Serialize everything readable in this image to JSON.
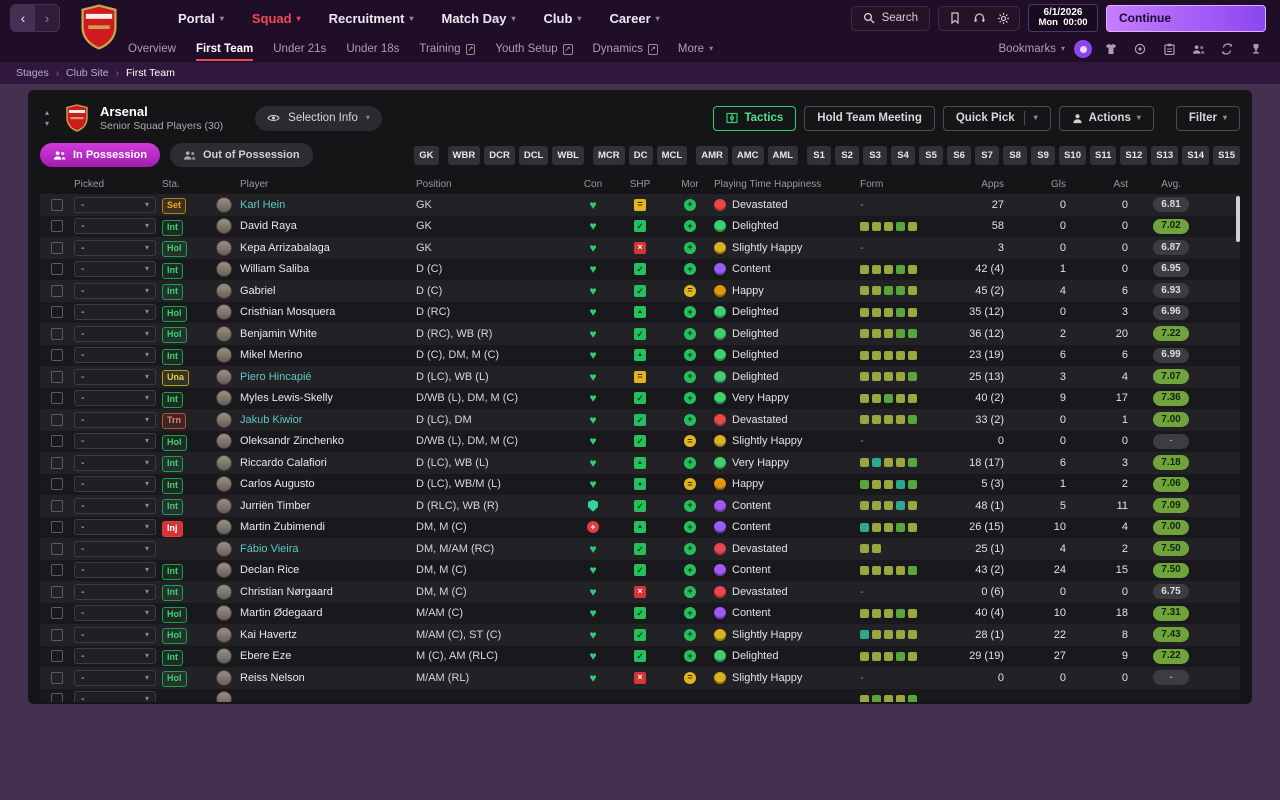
{
  "colors": {
    "bg-page": "#44304f",
    "bg-topbar": "#200e29",
    "accent-red": "#f14950",
    "accent-purple": "#8b46f0",
    "accent-purple-light": "#c77dff",
    "accent-magenta": "#a21caf",
    "accent-green": "#2fd06f",
    "link-teal": "#5ec8be"
  },
  "icons": {
    "chevron_down": "▾",
    "tri_up": "▴",
    "tri_down": "▾",
    "back": "‹",
    "forward": "›",
    "heart": "♥",
    "check": "✓",
    "cross": "×",
    "equals": "=",
    "up": "▲",
    "plus": "+",
    "external": "↗",
    "sep": "›"
  },
  "topbar": {
    "menus": [
      {
        "label": "Portal"
      },
      {
        "label": "Squad",
        "active": true
      },
      {
        "label": "Recruitment"
      },
      {
        "label": "Match Day"
      },
      {
        "label": "Club"
      },
      {
        "label": "Career"
      }
    ],
    "search_label": "Search",
    "date": {
      "date": "6/1/2026",
      "day": "Mon",
      "time": "00:00"
    },
    "continue_label": "Continue"
  },
  "subnav": {
    "items": [
      {
        "label": "Overview"
      },
      {
        "label": "First Team",
        "active": true
      },
      {
        "label": "Under 21s"
      },
      {
        "label": "Under 18s"
      },
      {
        "label": "Training",
        "ext": true
      },
      {
        "label": "Youth Setup",
        "ext": true
      },
      {
        "label": "Dynamics",
        "ext": true
      },
      {
        "label": "More",
        "chevron": true
      }
    ],
    "bookmarks_label": "Bookmarks"
  },
  "breadcrumb": [
    "Stages",
    "Club Site",
    "First Team"
  ],
  "panel": {
    "club_name": "Arsenal",
    "subtitle": "Senior Squad Players (30)",
    "selection_info_label": "Selection Info",
    "buttons": {
      "tactics": "Tactics",
      "hold_team_meeting": "Hold Team Meeting",
      "quick_pick": "Quick Pick",
      "actions": "Actions",
      "filter": "Filter"
    },
    "possession": {
      "in": "In Possession",
      "out": "Out of Possession"
    },
    "position_filters": {
      "groups": [
        [
          "GK"
        ],
        [
          "WBR",
          "DCR",
          "DCL",
          "WBL"
        ],
        [
          "MCR",
          "DC",
          "MCL"
        ],
        [
          "AMR",
          "AMC",
          "AML"
        ],
        [
          "S1",
          "S2",
          "S3",
          "S4",
          "S5",
          "S6",
          "S7",
          "S8",
          "S9",
          "S10",
          "S11",
          "S12",
          "S13",
          "S14",
          "S15"
        ]
      ]
    }
  },
  "table": {
    "columns": [
      "Picked",
      "Sta.",
      "Player",
      "Position",
      "Con",
      "SHP",
      "Mor",
      "Playing Time Happiness",
      "Form",
      "Apps",
      "Gls",
      "Ast",
      "Avg."
    ],
    "rows": [
      {
        "picked": "-",
        "status": "Set",
        "status_type": "set",
        "name": "Karl Hein",
        "link": true,
        "position": "GK",
        "con": "heart",
        "shp": "eq",
        "mor": "good",
        "happiness": "Devastated",
        "happiness_type": "devastated",
        "form": [],
        "apps": "27",
        "gls": "0",
        "ast": "0",
        "avg": "6.81",
        "avg_type": "gray"
      },
      {
        "picked": "-",
        "status": "Int",
        "status_type": "int",
        "name": "David Raya",
        "link": false,
        "position": "GK",
        "con": "heart",
        "shp": "check",
        "mor": "good",
        "happiness": "Delighted",
        "happiness_type": "delighted",
        "form": [
          "o",
          "o",
          "o",
          "g",
          "o"
        ],
        "apps": "58",
        "gls": "0",
        "ast": "0",
        "avg": "7.02",
        "avg_type": "green"
      },
      {
        "picked": "-",
        "status": "Hol",
        "status_type": "hol",
        "name": "Kepa Arrizabalaga",
        "link": false,
        "position": "GK",
        "con": "heart",
        "shp": "x",
        "mor": "good",
        "happiness": "Slightly Happy",
        "happiness_type": "slightly",
        "form": [],
        "apps": "3",
        "gls": "0",
        "ast": "0",
        "avg": "6.87",
        "avg_type": "gray"
      },
      {
        "picked": "-",
        "status": "Int",
        "status_type": "int",
        "name": "William Saliba",
        "link": false,
        "position": "D (C)",
        "con": "heart",
        "shp": "check",
        "mor": "good",
        "happiness": "Content",
        "happiness_type": "content",
        "form": [
          "o",
          "o",
          "o",
          "g",
          "o"
        ],
        "apps": "42 (4)",
        "gls": "1",
        "ast": "0",
        "avg": "6.95",
        "avg_type": "gray"
      },
      {
        "picked": "-",
        "status": "Int",
        "status_type": "int",
        "name": "Gabriel",
        "link": false,
        "position": "D (C)",
        "con": "heart",
        "shp": "check",
        "mor": "ok",
        "happiness": "Happy",
        "happiness_type": "happy",
        "form": [
          "o",
          "o",
          "g",
          "g",
          "o"
        ],
        "apps": "45 (2)",
        "gls": "4",
        "ast": "6",
        "avg": "6.93",
        "avg_type": "gray"
      },
      {
        "picked": "-",
        "status": "Hol",
        "status_type": "hol",
        "name": "Cristhian Mosquera",
        "link": false,
        "position": "D (RC)",
        "con": "heart",
        "shp": "up",
        "mor": "good",
        "happiness": "Delighted",
        "happiness_type": "delighted",
        "form": [
          "o",
          "o",
          "o",
          "g",
          "o"
        ],
        "apps": "35 (12)",
        "gls": "0",
        "ast": "3",
        "avg": "6.96",
        "avg_type": "gray"
      },
      {
        "picked": "-",
        "status": "Hol",
        "status_type": "hol",
        "name": "Benjamin White",
        "link": false,
        "position": "D (RC), WB (R)",
        "con": "heart",
        "shp": "check",
        "mor": "good",
        "happiness": "Delighted",
        "happiness_type": "delighted",
        "form": [
          "o",
          "o",
          "o",
          "g",
          "g"
        ],
        "apps": "36 (12)",
        "gls": "2",
        "ast": "20",
        "avg": "7.22",
        "avg_type": "green"
      },
      {
        "picked": "-",
        "status": "Int",
        "status_type": "int",
        "name": "Mikel Merino",
        "link": false,
        "position": "D (C), DM, M (C)",
        "con": "heart",
        "shp": "up",
        "mor": "good",
        "happiness": "Delighted",
        "happiness_type": "delighted",
        "form": [
          "o",
          "o",
          "o",
          "o",
          "o"
        ],
        "apps": "23 (19)",
        "gls": "6",
        "ast": "6",
        "avg": "6.99",
        "avg_type": "gray"
      },
      {
        "picked": "-",
        "status": "Una",
        "status_type": "una",
        "name": "Piero Hincapié",
        "link": true,
        "position": "D (LC), WB (L)",
        "con": "heart",
        "shp": "eq",
        "mor": "good",
        "happiness": "Delighted",
        "happiness_type": "delighted",
        "form": [
          "o",
          "o",
          "o",
          "o",
          "g"
        ],
        "apps": "25 (13)",
        "gls": "3",
        "ast": "4",
        "avg": "7.07",
        "avg_type": "green"
      },
      {
        "picked": "-",
        "status": "Int",
        "status_type": "int",
        "name": "Myles Lewis-Skelly",
        "link": false,
        "position": "D/WB (L), DM, M (C)",
        "con": "heart",
        "shp": "check",
        "mor": "good",
        "happiness": "Very Happy",
        "happiness_type": "very",
        "form": [
          "o",
          "o",
          "g",
          "o",
          "o"
        ],
        "apps": "40 (2)",
        "gls": "9",
        "ast": "17",
        "avg": "7.36",
        "avg_type": "green"
      },
      {
        "picked": "-",
        "status": "Trn",
        "status_type": "trn",
        "name": "Jakub Kiwior",
        "link": true,
        "position": "D (LC), DM",
        "con": "heart",
        "shp": "check",
        "mor": "good",
        "happiness": "Devastated",
        "happiness_type": "devastated",
        "form": [
          "o",
          "o",
          "o",
          "o",
          "g"
        ],
        "apps": "33 (2)",
        "gls": "0",
        "ast": "1",
        "avg": "7.00",
        "avg_type": "green"
      },
      {
        "picked": "-",
        "status": "Hol",
        "status_type": "hol",
        "name": "Oleksandr Zinchenko",
        "link": false,
        "position": "D/WB (L), DM, M (C)",
        "con": "heart",
        "shp": "check",
        "mor": "ok",
        "happiness": "Slightly Happy",
        "happiness_type": "slightly",
        "form": [],
        "apps": "0",
        "gls": "0",
        "ast": "0",
        "avg": "-",
        "avg_type": "dash"
      },
      {
        "picked": "-",
        "status": "Int",
        "status_type": "int",
        "name": "Riccardo Calafiori",
        "link": false,
        "position": "D (LC), WB (L)",
        "con": "heart",
        "shp": "up",
        "mor": "good",
        "happiness": "Very Happy",
        "happiness_type": "very",
        "form": [
          "o",
          "t",
          "o",
          "o",
          "g"
        ],
        "apps": "18 (17)",
        "gls": "6",
        "ast": "3",
        "avg": "7.18",
        "avg_type": "green"
      },
      {
        "picked": "-",
        "status": "Int",
        "status_type": "int",
        "name": "Carlos Augusto",
        "link": false,
        "position": "D (LC), WB/M (L)",
        "con": "heart",
        "shp": "up",
        "mor": "ok",
        "happiness": "Happy",
        "happiness_type": "happy",
        "form": [
          "g",
          "o",
          "o",
          "t",
          "g"
        ],
        "apps": "5 (3)",
        "gls": "1",
        "ast": "2",
        "avg": "7.06",
        "avg_type": "green"
      },
      {
        "picked": "-",
        "status": "Int",
        "status_type": "int",
        "name": "Jurriën Timber",
        "link": false,
        "position": "D (RLC), WB (R)",
        "con": "shield",
        "shp": "check",
        "mor": "good",
        "happiness": "Content",
        "happiness_type": "content",
        "form": [
          "o",
          "o",
          "o",
          "t",
          "o"
        ],
        "apps": "48 (1)",
        "gls": "5",
        "ast": "11",
        "avg": "7.09",
        "avg_type": "green"
      },
      {
        "picked": "-",
        "status": "Inj",
        "status_type": "inj",
        "name": "Martin Zubimendi",
        "link": false,
        "position": "DM, M (C)",
        "con": "cross",
        "shp": "up",
        "mor": "good",
        "happiness": "Content",
        "happiness_type": "content",
        "form": [
          "t",
          "o",
          "o",
          "g",
          "o"
        ],
        "apps": "26 (15)",
        "gls": "10",
        "ast": "4",
        "avg": "7.00",
        "avg_type": "green"
      },
      {
        "picked": "-",
        "status": "",
        "status_type": "",
        "name": "Fábio Vieira",
        "link": true,
        "position": "DM, M/AM (RC)",
        "con": "heart",
        "shp": "check",
        "mor": "good",
        "happiness": "Devastated",
        "happiness_type": "devastated",
        "form": [
          "o",
          "o"
        ],
        "apps": "25 (1)",
        "gls": "4",
        "ast": "2",
        "avg": "7.50",
        "avg_type": "green"
      },
      {
        "picked": "-",
        "status": "Int",
        "status_type": "int",
        "name": "Declan Rice",
        "link": false,
        "position": "DM, M (C)",
        "con": "heart",
        "shp": "check",
        "mor": "good",
        "happiness": "Content",
        "happiness_type": "content",
        "form": [
          "o",
          "o",
          "o",
          "o",
          "g"
        ],
        "apps": "43 (2)",
        "gls": "24",
        "ast": "15",
        "avg": "7.50",
        "avg_type": "green"
      },
      {
        "picked": "-",
        "status": "Int",
        "status_type": "int",
        "name": "Christian Nørgaard",
        "link": false,
        "position": "DM, M (C)",
        "con": "heart",
        "shp": "x",
        "mor": "good",
        "happiness": "Devastated",
        "happiness_type": "devastated",
        "form": [],
        "apps": "0 (6)",
        "gls": "0",
        "ast": "0",
        "avg": "6.75",
        "avg_type": "gray"
      },
      {
        "picked": "-",
        "status": "Hol",
        "status_type": "hol",
        "name": "Martin Ødegaard",
        "link": false,
        "position": "M/AM (C)",
        "con": "heart",
        "shp": "check",
        "mor": "good",
        "happiness": "Content",
        "happiness_type": "content",
        "form": [
          "o",
          "o",
          "o",
          "g",
          "o"
        ],
        "apps": "40 (4)",
        "gls": "10",
        "ast": "18",
        "avg": "7.31",
        "avg_type": "green"
      },
      {
        "picked": "-",
        "status": "Hol",
        "status_type": "hol",
        "name": "Kai Havertz",
        "link": false,
        "position": "M/AM (C), ST (C)",
        "con": "heart",
        "shp": "check",
        "mor": "good",
        "happiness": "Slightly Happy",
        "happiness_type": "slightly",
        "form": [
          "t",
          "o",
          "o",
          "o",
          "o"
        ],
        "apps": "28 (1)",
        "gls": "22",
        "ast": "8",
        "avg": "7.43",
        "avg_type": "green"
      },
      {
        "picked": "-",
        "status": "Int",
        "status_type": "int",
        "name": "Ebere Eze",
        "link": false,
        "position": "M (C), AM (RLC)",
        "con": "heart",
        "shp": "check",
        "mor": "good",
        "happiness": "Delighted",
        "happiness_type": "delighted",
        "form": [
          "o",
          "o",
          "o",
          "g",
          "o"
        ],
        "apps": "29 (19)",
        "gls": "27",
        "ast": "9",
        "avg": "7.22",
        "avg_type": "green"
      },
      {
        "picked": "-",
        "status": "Hol",
        "status_type": "hol",
        "name": "Reiss Nelson",
        "link": false,
        "position": "M/AM (RL)",
        "con": "heart",
        "shp": "x",
        "mor": "ok",
        "happiness": "Slightly Happy",
        "happiness_type": "slightly",
        "form": [],
        "apps": "0",
        "gls": "0",
        "ast": "0",
        "avg": "-",
        "avg_type": "dash"
      }
    ],
    "partial_row": {
      "picked": "-",
      "status": "",
      "status_type": "",
      "name": "",
      "link": false,
      "position": "",
      "con": "",
      "shp": "",
      "mor": "",
      "happiness": "",
      "happiness_type": "",
      "form": [
        "o",
        "g",
        "o",
        "o",
        "g"
      ],
      "apps": "",
      "gls": "",
      "ast": "",
      "avg": ""
    }
  }
}
